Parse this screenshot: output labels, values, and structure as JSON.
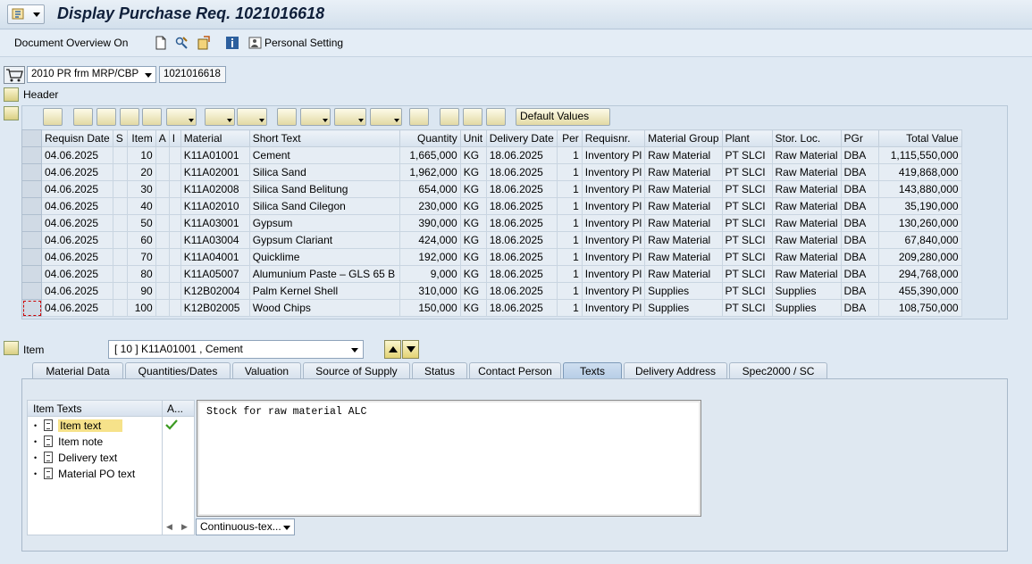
{
  "title": "Display Purchase Req. 1021016618",
  "app_toolbar": {
    "document_overview": "Document Overview On",
    "personal_setting": "Personal Setting"
  },
  "doc_type": {
    "value": "2010 PR frm MRP/CBP",
    "pr_number": "1021016618"
  },
  "header_label": "Header",
  "grid_toolbar": {
    "default_values": "Default Values"
  },
  "grid": {
    "columns": [
      "Requisn Date",
      "S",
      "Item",
      "A",
      "I",
      "Material",
      "Short Text",
      "Quantity",
      "Unit",
      "Delivery Date",
      "Per",
      "Requisnr.",
      "Material Group",
      "Plant",
      "Stor. Loc.",
      "PGr",
      "Total Value"
    ],
    "rows": [
      [
        "04.06.2025",
        "",
        "10",
        "",
        "",
        "K11A01001",
        "Cement",
        "1,665,000",
        "KG",
        "18.06.2025",
        "1",
        "Inventory Pl",
        "Raw Material",
        "PT SLCI",
        "Raw Material",
        "DBA",
        "1,115,550,000"
      ],
      [
        "04.06.2025",
        "",
        "20",
        "",
        "",
        "K11A02001",
        "Silica Sand",
        "1,962,000",
        "KG",
        "18.06.2025",
        "1",
        "Inventory Pl",
        "Raw Material",
        "PT SLCI",
        "Raw Material",
        "DBA",
        "419,868,000"
      ],
      [
        "04.06.2025",
        "",
        "30",
        "",
        "",
        "K11A02008",
        "Silica Sand Belitung",
        "654,000",
        "KG",
        "18.06.2025",
        "1",
        "Inventory Pl",
        "Raw Material",
        "PT SLCI",
        "Raw Material",
        "DBA",
        "143,880,000"
      ],
      [
        "04.06.2025",
        "",
        "40",
        "",
        "",
        "K11A02010",
        "Silica Sand Cilegon",
        "230,000",
        "KG",
        "18.06.2025",
        "1",
        "Inventory Pl",
        "Raw Material",
        "PT SLCI",
        "Raw Material",
        "DBA",
        "35,190,000"
      ],
      [
        "04.06.2025",
        "",
        "50",
        "",
        "",
        "K11A03001",
        "Gypsum",
        "390,000",
        "KG",
        "18.06.2025",
        "1",
        "Inventory Pl",
        "Raw Material",
        "PT SLCI",
        "Raw Material",
        "DBA",
        "130,260,000"
      ],
      [
        "04.06.2025",
        "",
        "60",
        "",
        "",
        "K11A03004",
        "Gypsum Clariant",
        "424,000",
        "KG",
        "18.06.2025",
        "1",
        "Inventory Pl",
        "Raw Material",
        "PT SLCI",
        "Raw Material",
        "DBA",
        "67,840,000"
      ],
      [
        "04.06.2025",
        "",
        "70",
        "",
        "",
        "K11A04001",
        "Quicklime",
        "192,000",
        "KG",
        "18.06.2025",
        "1",
        "Inventory Pl",
        "Raw Material",
        "PT SLCI",
        "Raw Material",
        "DBA",
        "209,280,000"
      ],
      [
        "04.06.2025",
        "",
        "80",
        "",
        "",
        "K11A05007",
        "Alumunium Paste – GLS 65 B",
        "9,000",
        "KG",
        "18.06.2025",
        "1",
        "Inventory Pl",
        "Raw Material",
        "PT SLCI",
        "Raw Material",
        "DBA",
        "294,768,000"
      ],
      [
        "04.06.2025",
        "",
        "90",
        "",
        "",
        "K12B02004",
        "Palm Kernel Shell",
        "310,000",
        "KG",
        "18.06.2025",
        "1",
        "Inventory Pl",
        "Supplies",
        "PT SLCI",
        "Supplies",
        "DBA",
        "455,390,000"
      ],
      [
        "04.06.2025",
        "",
        "100",
        "",
        "",
        "K12B02005",
        "Wood Chips",
        "150,000",
        "KG",
        "18.06.2025",
        "1",
        "Inventory Pl",
        "Supplies",
        "PT SLCI",
        "Supplies",
        "DBA",
        "108,750,000"
      ]
    ]
  },
  "item_section": {
    "label": "Item",
    "selected_item": "[ 10 ] K11A01001 , Cement"
  },
  "tabs": [
    "Material Data",
    "Quantities/Dates",
    "Valuation",
    "Source of Supply",
    "Status",
    "Contact Person",
    "Texts",
    "Delivery Address",
    "Spec2000 / SC"
  ],
  "active_tab": "Texts",
  "item_texts": {
    "header": "Item Texts",
    "col2_header": "A...",
    "items": [
      "Item text",
      "Item note",
      "Delivery text",
      "Material PO text"
    ]
  },
  "editor_text": "Stock for raw material ALC",
  "format_select": "Continuous-tex...",
  "colors": {
    "background": "#dfe9f3",
    "tab_active": "#b6cde6",
    "title": "#0f1f3a"
  }
}
